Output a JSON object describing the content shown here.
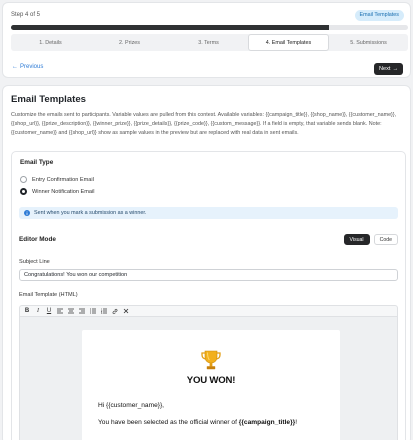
{
  "wizard": {
    "step_count": "Step 4 of 5",
    "chip": "Email Templates",
    "progress_fraction": 0.8,
    "steps": [
      {
        "label": "1. Details",
        "active": false
      },
      {
        "label": "2. Prizes",
        "active": false
      },
      {
        "label": "3. Terms",
        "active": false
      },
      {
        "label": "4. Email Templates",
        "active": true
      },
      {
        "label": "5. Submissions",
        "active": false
      }
    ],
    "previous_label": "Previous",
    "next_label": "Next"
  },
  "main": {
    "title": "Email Templates",
    "description": "Customize the emails sent to participants. Variable values are pulled from this contest. Available variables: {{campaign_title}}, {{shop_name}}, {{customer_name}}, {{shop_url}}, {{prize_description}}, {{winner_prize}}, {{prize_details}}, {{prize_code}}, {{custom_message}}. If a field is empty, that variable sends blank. Note: {{customer_name}} and {{shop_url}} show as sample values in the preview but are replaced with real data in sent emails."
  },
  "email_type": {
    "title": "Email Type",
    "options": [
      {
        "label": "Entry Confirmation Email",
        "checked": false
      },
      {
        "label": "Winner Notification Email",
        "checked": true
      }
    ],
    "info": "Sent when you mark a submission as a winner."
  },
  "editor_mode": {
    "title": "Editor Mode",
    "visual_label": "Visual",
    "code_label": "Code",
    "active": "Visual"
  },
  "subject": {
    "label": "Subject Line",
    "value": "Congratulations! You won our competition"
  },
  "template": {
    "label": "Email Template (HTML)",
    "toolbar": [
      "bold-icon",
      "italic-icon",
      "underline-icon",
      "align-left-icon",
      "align-center-icon",
      "align-right-icon",
      "bullet-list-icon",
      "numbered-list-icon",
      "link-icon",
      "clear-format-icon"
    ],
    "preview": {
      "heading": "YOU WON!",
      "greeting": "Hi {{customer_name}},",
      "body_prefix": "You have been selected as the official winner of ",
      "body_variable": "{{campaign_title}}",
      "body_suffix": "!"
    }
  },
  "colors": {
    "accent": "#2d7bd6",
    "dark": "#262729",
    "info_bg": "#e6f2fc"
  }
}
